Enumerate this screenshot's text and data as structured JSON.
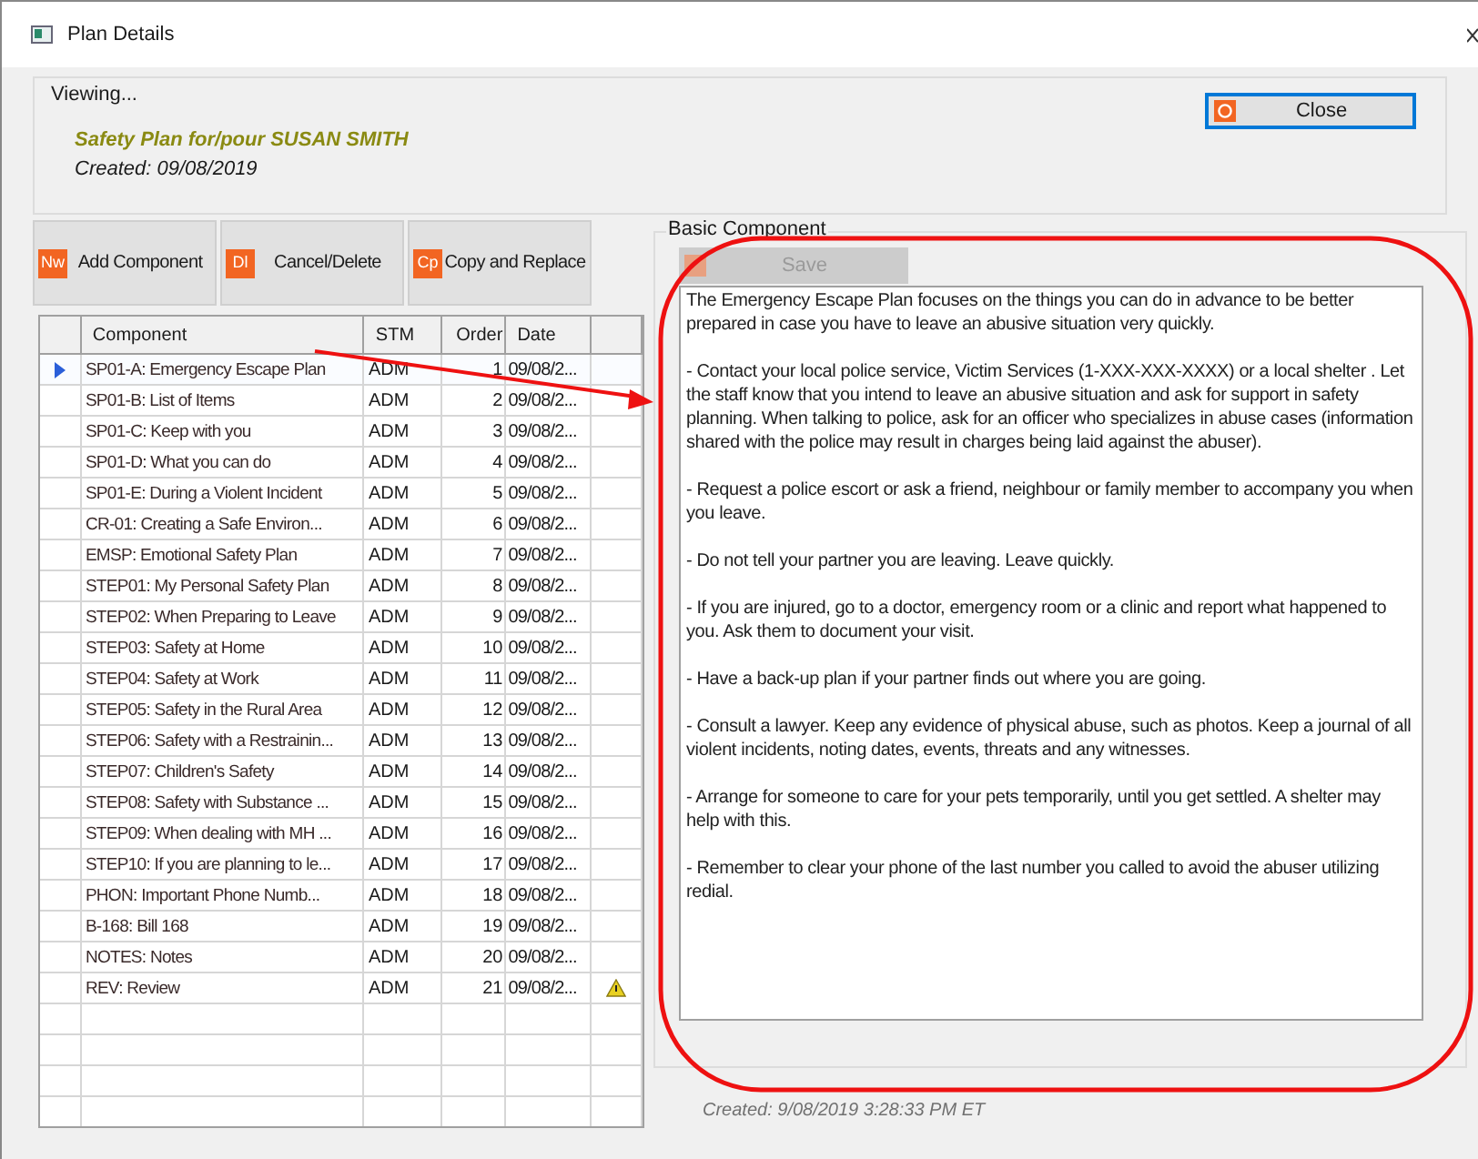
{
  "window": {
    "title": "Plan Details"
  },
  "viewing": {
    "label": "Viewing...",
    "plan_title": "Safety Plan for/pour SUSAN SMITH",
    "created": "Created: 09/08/2019"
  },
  "close_button": {
    "label": "Close"
  },
  "toolbar": [
    {
      "icon_text": "Nw",
      "label": "Add Component"
    },
    {
      "icon_text": "Dl",
      "label": "Cancel/Delete"
    },
    {
      "icon_text": "Cp",
      "label": "Copy and Replace"
    }
  ],
  "table": {
    "columns": [
      "Component",
      "STM",
      "Order",
      "Date"
    ],
    "rows": [
      {
        "component": "SP01-A: Emergency Escape Plan",
        "stm": "ADM",
        "order": "1",
        "date": "09/08/2...",
        "selected": true,
        "warning": false
      },
      {
        "component": "SP01-B: List of Items",
        "stm": "ADM",
        "order": "2",
        "date": "09/08/2...",
        "selected": false,
        "warning": false
      },
      {
        "component": "SP01-C: Keep with you",
        "stm": "ADM",
        "order": "3",
        "date": "09/08/2...",
        "selected": false,
        "warning": false
      },
      {
        "component": "SP01-D: What you can do",
        "stm": "ADM",
        "order": "4",
        "date": "09/08/2...",
        "selected": false,
        "warning": false
      },
      {
        "component": "SP01-E: During a Violent Incident",
        "stm": "ADM",
        "order": "5",
        "date": "09/08/2...",
        "selected": false,
        "warning": false
      },
      {
        "component": "CR-01: Creating a Safe Environ...",
        "stm": "ADM",
        "order": "6",
        "date": "09/08/2...",
        "selected": false,
        "warning": false
      },
      {
        "component": "EMSP: Emotional Safety Plan",
        "stm": "ADM",
        "order": "7",
        "date": "09/08/2...",
        "selected": false,
        "warning": false
      },
      {
        "component": "STEP01: My Personal Safety Plan",
        "stm": "ADM",
        "order": "8",
        "date": "09/08/2...",
        "selected": false,
        "warning": false
      },
      {
        "component": "STEP02: When Preparing to Leave",
        "stm": "ADM",
        "order": "9",
        "date": "09/08/2...",
        "selected": false,
        "warning": false
      },
      {
        "component": "STEP03: Safety at Home",
        "stm": "ADM",
        "order": "10",
        "date": "09/08/2...",
        "selected": false,
        "warning": false
      },
      {
        "component": "STEP04: Safety at Work",
        "stm": "ADM",
        "order": "11",
        "date": "09/08/2...",
        "selected": false,
        "warning": false
      },
      {
        "component": "STEP05: Safety in the Rural Area",
        "stm": "ADM",
        "order": "12",
        "date": "09/08/2...",
        "selected": false,
        "warning": false
      },
      {
        "component": "STEP06: Safety with a Restrainin...",
        "stm": "ADM",
        "order": "13",
        "date": "09/08/2...",
        "selected": false,
        "warning": false
      },
      {
        "component": "STEP07: Children's Safety",
        "stm": "ADM",
        "order": "14",
        "date": "09/08/2...",
        "selected": false,
        "warning": false
      },
      {
        "component": "STEP08: Safety with Substance ...",
        "stm": "ADM",
        "order": "15",
        "date": "09/08/2...",
        "selected": false,
        "warning": false
      },
      {
        "component": "STEP09: When dealing with MH ...",
        "stm": "ADM",
        "order": "16",
        "date": "09/08/2...",
        "selected": false,
        "warning": false
      },
      {
        "component": "STEP10: If you are planning to le...",
        "stm": "ADM",
        "order": "17",
        "date": "09/08/2...",
        "selected": false,
        "warning": false
      },
      {
        "component": "PHON: Important Phone Numb...",
        "stm": "ADM",
        "order": "18",
        "date": "09/08/2...",
        "selected": false,
        "warning": false
      },
      {
        "component": "B-168: Bill 168",
        "stm": "ADM",
        "order": "19",
        "date": "09/08/2...",
        "selected": false,
        "warning": false
      },
      {
        "component": "NOTES: Notes",
        "stm": "ADM",
        "order": "20",
        "date": "09/08/2...",
        "selected": false,
        "warning": false
      },
      {
        "component": "REV: Review",
        "stm": "ADM",
        "order": "21",
        "date": "09/08/2...",
        "selected": false,
        "warning": true
      }
    ]
  },
  "basic_component": {
    "label": "Basic Component",
    "save_button": {
      "label": "Save",
      "disabled": true
    },
    "paragraphs": [
      "The Emergency Escape Plan focuses on the things you can do in advance to be better prepared in case you have to leave an abusive situation very quickly.",
      "- Contact your local police service, Victim Services (1-XXX-XXX-XXXX) or a local shelter . Let the staff know that you intend to leave an abusive situation and ask for support in safety planning. When talking to police, ask for an officer who specializes in abuse cases (information shared with the police may result in charges being laid against the abuser).",
      "- Request a police escort or ask a friend, neighbour or family member to accompany you when you leave.",
      "- Do not tell your partner you are leaving. Leave quickly.",
      "- If you are injured, go to a doctor, emergency room or a clinic and report what happened to you. Ask them to document your visit.",
      "- Have a back-up plan if your partner finds out where you are going.",
      "- Consult a lawyer. Keep any evidence of physical abuse, such as photos. Keep a journal of all violent incidents, noting dates, events, threats and any witnesses.",
      "- Arrange for someone to care for your pets temporarily, until you get settled. A shelter may help with this.",
      "- Remember to clear your phone of the last number you called to avoid the abuser utilizing redial."
    ]
  },
  "footer": {
    "created": "Created: 9/08/2019 3:28:33 PM ET"
  }
}
